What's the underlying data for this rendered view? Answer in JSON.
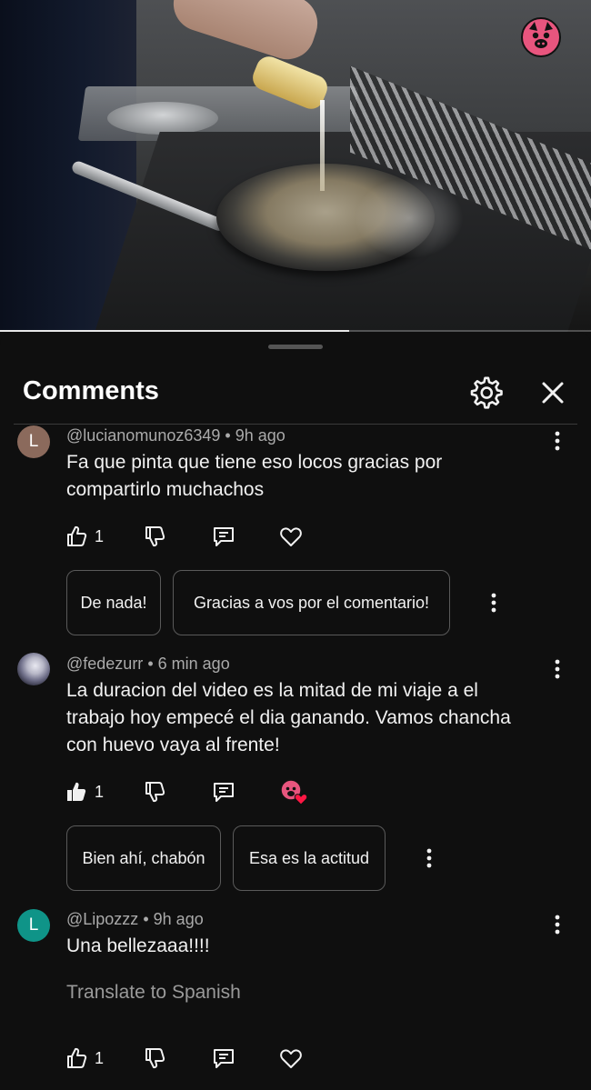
{
  "video": {
    "progress_fraction": 0.59,
    "channel_logo_icon": "pig-mascot-logo"
  },
  "comments_panel": {
    "title": "Comments",
    "settings_icon": "gear-icon",
    "close_icon": "close-icon"
  },
  "comments": [
    {
      "avatar_letter": "L",
      "avatar_color": "#8b6a5c",
      "author": "@lucianomunoz6349",
      "time": "9h ago",
      "text_line1": "Fa que pinta que tiene eso locos gracias por",
      "text_line2": "compartirlo muchachos",
      "likes": "1",
      "liked": false,
      "reply_suggestions": [
        "De nada!",
        "Gracias a vos por el comentario!"
      ]
    },
    {
      "avatar_letter": "",
      "author": "@fedezurr",
      "time": "6 min ago",
      "text_line1": "La duracion del video es la mitad de mi viaje a el",
      "text_line2": "trabajo hoy empecé el dia ganando. Vamos chancha",
      "text_line3": "con huevo vaya al frente!",
      "likes": "1",
      "liked": true,
      "creator_heart": true,
      "reply_suggestions": [
        "Bien ahí, chabón",
        "Esa es la actitud"
      ]
    },
    {
      "avatar_letter": "L",
      "avatar_color": "#0f9488",
      "author": "@Lipozzz",
      "time": "9h ago",
      "text_line1": "Una bellezaaa!!!!",
      "translate_label": "Translate to Spanish",
      "likes": "1",
      "liked": false
    }
  ],
  "meta_separator": "•"
}
